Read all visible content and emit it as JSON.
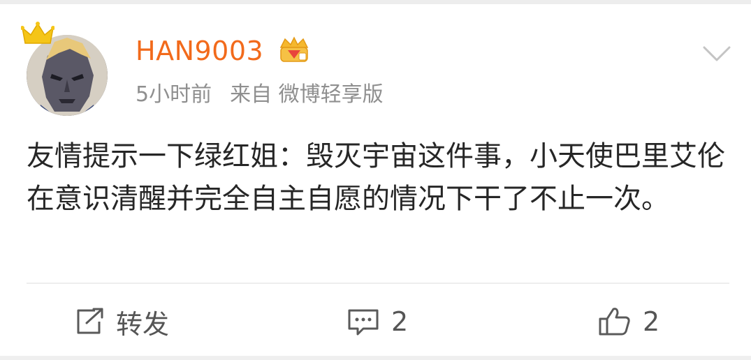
{
  "post": {
    "username": "HAN9003",
    "time": "5小时前",
    "source": "来自 微博轻享版",
    "content": "友情提示一下绿红姐：毁灭宇宙这件事，小天使巴里艾伦在意识清醒并完全自主自愿的情况下干了不止一次。"
  },
  "actions": {
    "repost_label": "转发",
    "comment_count": "2",
    "like_count": "2"
  },
  "icons": {
    "avatar_crown": "crown-icon",
    "vip_badge": "vip-crown-badge-icon",
    "menu": "chevron-down-icon",
    "repost": "share-arrow-icon",
    "comment": "comment-bubble-icon",
    "like": "thumbs-up-icon"
  },
  "colors": {
    "username": "#f26a1b",
    "meta": "#8f8f8f",
    "text": "#262626",
    "crown": "#f5c518"
  }
}
